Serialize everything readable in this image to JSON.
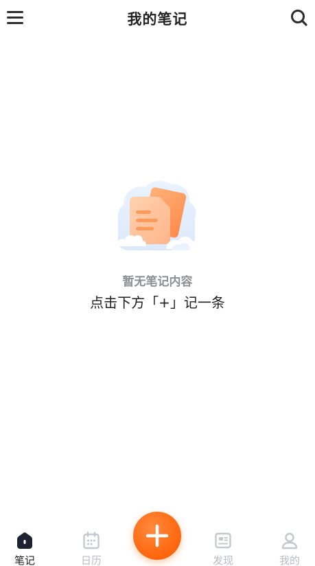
{
  "header": {
    "title": "我的笔记"
  },
  "empty_state": {
    "title": "暂无笔记内容",
    "hint": "点击下方「+」记一条"
  },
  "tabbar": {
    "items": [
      {
        "label": "笔记",
        "icon": "home-icon",
        "active": true
      },
      {
        "label": "日历",
        "icon": "calendar-icon",
        "active": false
      },
      {
        "label": "发现",
        "icon": "news-icon",
        "active": false
      },
      {
        "label": "我的",
        "icon": "user-icon",
        "active": false
      }
    ],
    "add_button": {
      "icon": "plus-icon"
    }
  },
  "colors": {
    "accent": "#ff6a12",
    "text_primary": "#1e1e1e",
    "text_muted": "#8b8e95",
    "tab_inactive": "#b9bcc3"
  }
}
